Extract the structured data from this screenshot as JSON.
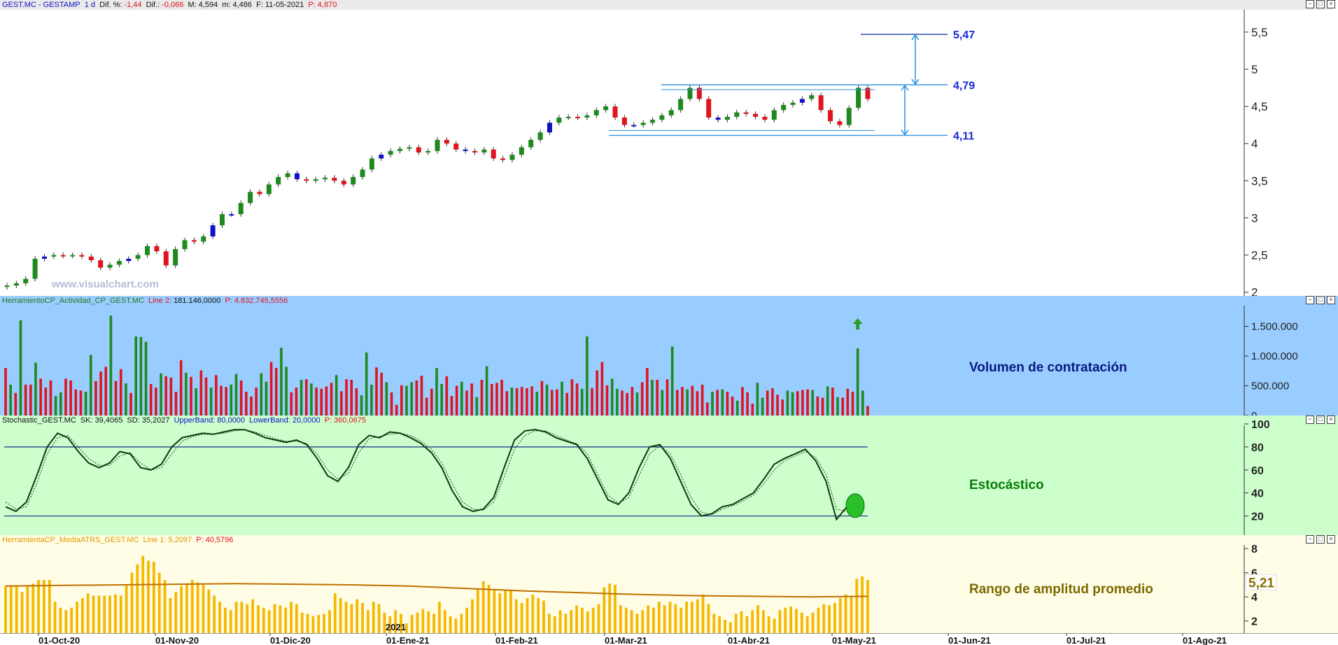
{
  "price_header": {
    "symbol": "GEST.MC - GESTAMP",
    "period": "1 d",
    "dif_pct_label": "Dif. %:",
    "dif_pct": "-1,44",
    "dif_label": "Dif.:",
    "dif": "-0,066",
    "max_label": "M:",
    "max": "4,594",
    "min_label": "m:",
    "min": "4,486",
    "date_label": "F:",
    "date": "11-05-2021",
    "price_label": "P:",
    "price": "4,870"
  },
  "volume_header": {
    "name": "HerramientoCP_Actividad_CP_GEST.MC",
    "line_label": "Line 2:",
    "line_value": "181.146,0000",
    "p_label": "P:",
    "p_value": "4.832.745,5556"
  },
  "stoch_header": {
    "name": "Stochastic_GEST.MC",
    "sk_label": "SK:",
    "sk": "39,4065",
    "sd_label": "SD:",
    "sd": "35,2027",
    "ub_label": "UpperBand:",
    "ub": "80,0000",
    "lb_label": "LowerBand:",
    "lb": "20,0000",
    "p_label": "P:",
    "p": "360,0675"
  },
  "atr_header": {
    "name": "HerramientaCP_MediaATRS_GEST.MC",
    "line_label": "Line 1:",
    "line_value": "5,2097",
    "p_label": "P:",
    "p_value": "40,5796"
  },
  "captions": {
    "volume": "Volumen de contratación",
    "stochastic": "Estocástico",
    "atr": "Rango de amplitud promedio"
  },
  "watermark": "www.visualchart.com",
  "year_marker": "2021",
  "atr_current_label": "5,21",
  "window_buttons": [
    "−",
    "□",
    "×"
  ],
  "colors": {
    "up": "#1e8a1e",
    "down": "#e0141e",
    "doji": "#1010c8",
    "level_line": "#2a8fe0",
    "volume_bg": "#99ccff",
    "stoch_bg": "#ccffcc",
    "atr_bg": "#fffde6",
    "atr_bar": "#f5b800",
    "atr_line": "#c07000"
  },
  "chart_data": [
    {
      "type": "candlestick",
      "title": "GEST.MC - GESTAMP",
      "x_ticks": [
        "01-Oct-20",
        "01-Nov-20",
        "01-Dic-20",
        "01-Ene-21",
        "01-Feb-21",
        "01-Mar-21",
        "01-Abr-21",
        "01-May-21",
        "01-Jun-21",
        "01-Jul-21",
        "01-Ago-21"
      ],
      "y_ticks": [
        "2",
        "2,5",
        "3",
        "3,5",
        "4",
        "4,5",
        "5",
        "5,5"
      ],
      "ylim": [
        1.95,
        5.8
      ],
      "levels": [
        {
          "label": "5,47",
          "value": 5.47
        },
        {
          "label": "4,79",
          "value": 4.79
        },
        {
          "label": "4,11",
          "value": 4.11
        }
      ],
      "close_series": [
        2.09,
        2.12,
        2.18,
        2.45,
        2.48,
        2.5,
        2.49,
        2.5,
        2.48,
        2.43,
        2.33,
        2.37,
        2.42,
        2.45,
        2.5,
        2.62,
        2.55,
        2.36,
        2.58,
        2.7,
        2.68,
        2.75,
        2.9,
        3.05,
        3.05,
        3.2,
        3.35,
        3.32,
        3.45,
        3.55,
        3.6,
        3.52,
        3.5,
        3.52,
        3.54,
        3.5,
        3.45,
        3.55,
        3.65,
        3.8,
        3.85,
        3.9,
        3.93,
        3.95,
        3.88,
        3.9,
        4.05,
        4.0,
        3.92,
        3.9,
        3.88,
        3.92,
        3.8,
        3.78,
        3.85,
        3.95,
        4.05,
        4.15,
        4.28,
        4.35,
        4.36,
        4.35,
        4.38,
        4.45,
        4.5,
        4.35,
        4.25,
        4.25,
        4.28,
        4.32,
        4.38,
        4.45,
        4.6,
        4.75,
        4.6,
        4.35,
        4.32,
        4.36,
        4.42,
        4.4,
        4.36,
        4.32,
        4.45,
        4.52,
        4.55,
        4.6,
        4.65,
        4.45,
        4.3,
        4.25,
        4.48,
        4.75,
        4.6
      ]
    },
    {
      "type": "bar",
      "title": "Volumen de contratación",
      "y_ticks": [
        "0",
        "500.000",
        "1.000.000",
        "1.500.000"
      ],
      "ylim": [
        0,
        1800000
      ],
      "values": [
        800000,
        520000,
        380000,
        1600000,
        520000,
        520000,
        890000,
        620000,
        470000,
        590000,
        330000,
        390000,
        620000,
        590000,
        440000,
        420000,
        400000,
        1020000,
        580000,
        740000,
        820000,
        1680000,
        580000,
        780000,
        540000,
        380000,
        1330000,
        1320000,
        1240000,
        530000,
        470000,
        710000,
        660000,
        640000,
        400000,
        930000,
        720000,
        650000,
        460000,
        760000,
        640000,
        470000,
        680000,
        500000,
        480000,
        520000,
        700000,
        590000,
        400000,
        320000,
        470000,
        710000,
        570000,
        900000,
        800000,
        1140000,
        820000,
        390000,
        470000,
        600000,
        610000,
        540000,
        470000,
        450000,
        490000,
        550000,
        680000,
        410000,
        610000,
        600000,
        460000,
        340000,
        1060000,
        520000,
        810000,
        720000,
        560000,
        390000,
        180000,
        510000,
        500000,
        560000,
        590000,
        670000,
        300000,
        450000,
        800000,
        530000,
        660000,
        330000,
        500000,
        570000,
        420000,
        540000,
        310000,
        600000,
        830000,
        530000,
        550000,
        600000,
        410000,
        470000,
        460000,
        480000,
        460000,
        490000,
        400000,
        580000,
        520000,
        430000,
        440000,
        570000,
        380000,
        610000,
        540000,
        450000,
        1330000,
        460000,
        760000,
        900000,
        510000,
        620000,
        450000,
        420000,
        380000,
        480000,
        390000,
        560000,
        800000,
        600000,
        600000,
        430000,
        610000,
        1160000,
        430000,
        480000,
        440000,
        500000,
        410000,
        520000,
        220000,
        400000,
        430000,
        440000,
        400000,
        320000,
        250000,
        480000,
        390000,
        200000,
        550000,
        300000,
        420000,
        460000,
        350000,
        270000,
        420000,
        390000,
        410000,
        430000,
        440000,
        430000,
        320000,
        300000,
        490000,
        470000,
        310000,
        300000,
        450000,
        400000,
        1130000,
        420000,
        160000
      ],
      "arrow_marker": "up"
    },
    {
      "type": "line",
      "title": "Estocástico",
      "y_ticks": [
        "20",
        "40",
        "60",
        "80",
        "100"
      ],
      "ylim": [
        10,
        100
      ],
      "bands": [
        80,
        20
      ],
      "series": [
        {
          "values": [
            28,
            24,
            32,
            55,
            80,
            92,
            88,
            76,
            66,
            62,
            66,
            76,
            74,
            62,
            60,
            65,
            80,
            88,
            90,
            92,
            91,
            93,
            95,
            95,
            92,
            88,
            86,
            84,
            86,
            82,
            70,
            55,
            50,
            62,
            82,
            90,
            88,
            93,
            92,
            88,
            83,
            75,
            62,
            42,
            28,
            24,
            26,
            36,
            62,
            86,
            94,
            95,
            93,
            88,
            85,
            82,
            70,
            52,
            34,
            30,
            40,
            62,
            80,
            82,
            70,
            50,
            30,
            20,
            22,
            28,
            30,
            35,
            40,
            52,
            65,
            70,
            74,
            78,
            68,
            50,
            17,
            28,
            38
          ]
        },
        {
          "values": [
            32,
            26,
            28,
            48,
            74,
            88,
            90,
            80,
            70,
            64,
            64,
            72,
            75,
            66,
            60,
            62,
            74,
            85,
            89,
            91,
            91,
            92,
            94,
            95,
            93,
            90,
            87,
            85,
            85,
            83,
            74,
            60,
            52,
            57,
            75,
            87,
            89,
            91,
            92,
            90,
            85,
            78,
            66,
            48,
            32,
            26,
            25,
            32,
            54,
            78,
            90,
            94,
            94,
            90,
            86,
            83,
            74,
            56,
            38,
            31,
            36,
            55,
            74,
            81,
            74,
            56,
            36,
            23,
            21,
            26,
            29,
            33,
            38,
            48,
            60,
            68,
            72,
            76,
            71,
            56,
            26,
            24,
            33
          ]
        }
      ]
    },
    {
      "type": "bar",
      "title": "Rango de amplitud promedio",
      "y_ticks": [
        "2",
        "4",
        "6",
        "8"
      ],
      "ylim": [
        1,
        8.3
      ],
      "values": [
        4.9,
        4.9,
        4.9,
        4.4,
        4.9,
        5.1,
        5.4,
        5.4,
        5.4,
        3.6,
        3.1,
        2.9,
        3.1,
        3.6,
        3.9,
        4.3,
        4.1,
        4.1,
        4.1,
        4.1,
        4.2,
        4.1,
        5.0,
        6.0,
        6.7,
        7.4,
        7.0,
        6.9,
        6.0,
        5.4,
        3.9,
        4.4,
        4.9,
        5.1,
        5.4,
        5.2,
        5.0,
        4.6,
        4.1,
        3.6,
        3.1,
        2.9,
        3.6,
        3.6,
        3.4,
        3.8,
        3.3,
        3.1,
        2.9,
        3.4,
        3.3,
        3.1,
        3.6,
        3.4,
        2.7,
        2.6,
        2.4,
        2.5,
        2.6,
        2.9,
        4.3,
        3.9,
        3.6,
        3.4,
        3.8,
        3.5,
        2.9,
        3.6,
        3.4,
        2.7,
        2.4,
        2.9,
        2.6,
        1.8,
        2.5,
        2.7,
        3.0,
        2.8,
        2.6,
        3.6,
        2.9,
        2.4,
        2.2,
        2.6,
        3.1,
        3.8,
        4.6,
        5.3,
        5.0,
        4.6,
        4.3,
        4.6,
        4.6,
        3.8,
        3.5,
        3.9,
        4.2,
        3.9,
        3.7,
        2.6,
        2.4,
        2.9,
        2.6,
        2.9,
        3.3,
        3.1,
        2.8,
        3.1,
        3.4,
        4.8,
        5.1,
        5.0,
        3.3,
        3.1,
        2.9,
        2.6,
        2.9,
        3.3,
        3.1,
        3.6,
        3.3,
        3.6,
        3.4,
        3.1,
        3.6,
        3.6,
        3.8,
        4.2,
        3.4,
        2.6,
        2.4,
        2.1,
        1.9,
        2.6,
        2.8,
        2.4,
        2.9,
        3.3,
        2.9,
        2.4,
        2.2,
        2.9,
        3.1,
        3.2,
        3.0,
        2.7,
        2.4,
        2.7,
        3.1,
        3.4,
        3.3,
        3.5,
        3.9,
        4.2,
        4.0,
        5.5,
        5.7,
        5.4
      ],
      "line": {
        "name": "Line 1",
        "values": [
          4.9,
          4.95,
          5.0,
          5.05,
          5.1,
          5.05,
          5.0,
          4.9,
          4.7,
          4.5,
          4.35,
          4.2,
          4.1,
          4.05,
          4.0,
          4.05
        ]
      }
    }
  ]
}
